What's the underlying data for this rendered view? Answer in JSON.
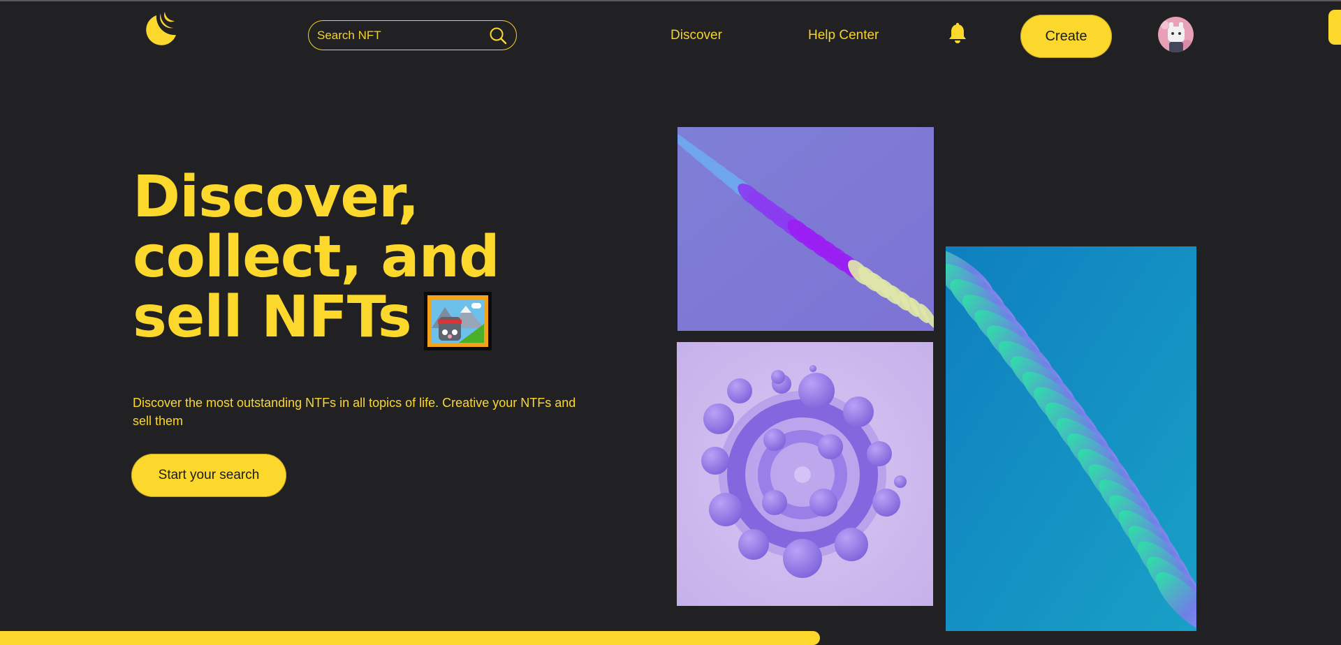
{
  "header": {
    "logo_icon": "crescent-moon-logo-icon",
    "search": {
      "placeholder": "Search NFT",
      "value": "",
      "icon": "search-icon"
    },
    "nav": [
      {
        "label": "Discover"
      },
      {
        "label": "Help Center"
      }
    ],
    "bell_icon": "bell-icon",
    "create_label": "Create",
    "avatar_icon": "avatar"
  },
  "hero": {
    "title_lines": [
      "Discover,",
      "collect, and",
      "sell NFTs"
    ],
    "title_emoji": "framed-picture-emoji",
    "description": "Discover the most outstanding NTFs in all topics of life. Creative your NTFs and sell them",
    "cta_label": "Start your search"
  },
  "gallery": [
    {
      "name": "purple-ribbon-artwork"
    },
    {
      "name": "lavender-swirl-artwork"
    },
    {
      "name": "teal-wave-artwork"
    }
  ],
  "colors": {
    "background": "#212124",
    "accent": "#fcd82d",
    "button_text": "#1c1c1c"
  }
}
